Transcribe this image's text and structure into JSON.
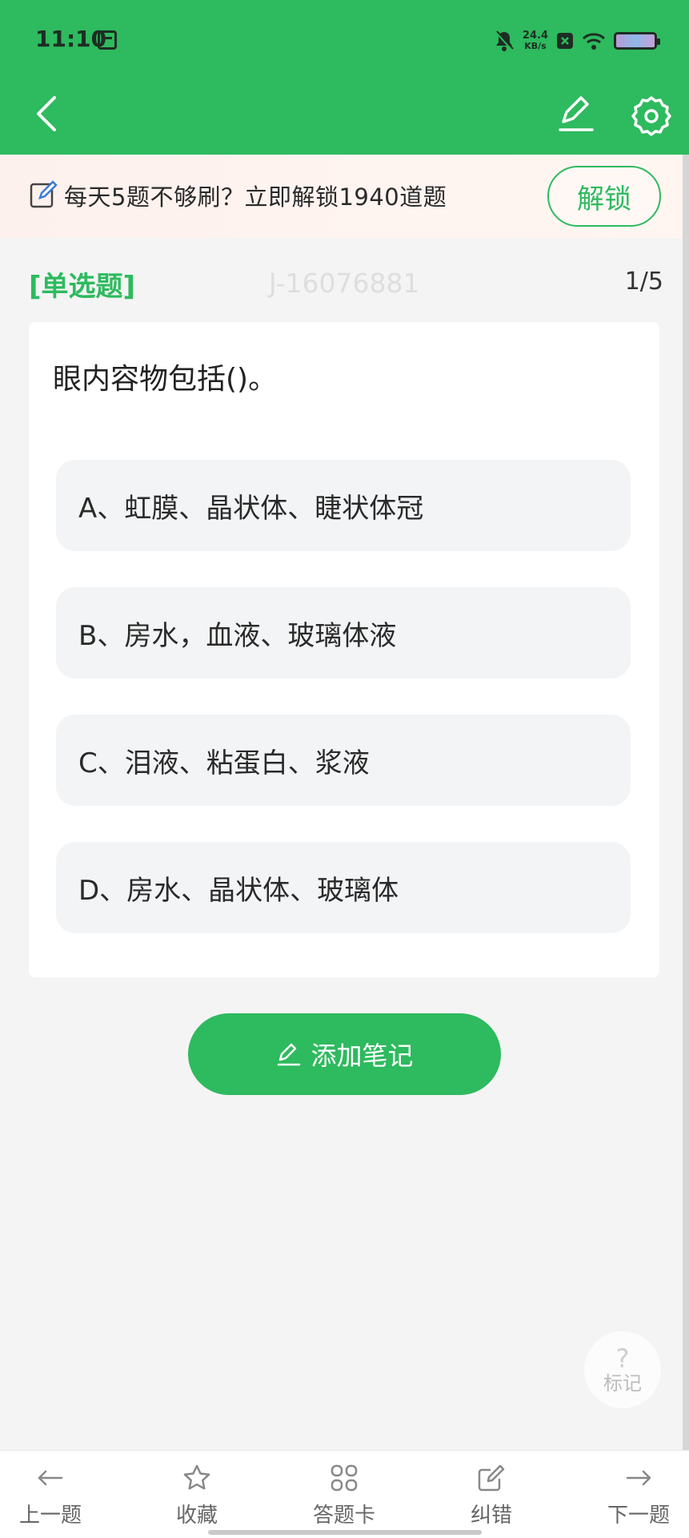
{
  "status_bar": {
    "time": "11:10",
    "net_speed_value": "24.4",
    "net_speed_unit": "KB/s"
  },
  "header": {
    "back_icon": "chevron-left-icon",
    "edit_icon": "pencil-icon",
    "settings_icon": "gear-icon"
  },
  "banner": {
    "text": "每天5题不够刷？立即解锁1940道题",
    "unlock_label": "解锁"
  },
  "question": {
    "type": "[单选题]",
    "id": "J-16076881",
    "progress": "1/5",
    "text": "眼内容物包括()。",
    "options": [
      {
        "label": "A、虹膜、晶状体、睫状体冠"
      },
      {
        "label": "B、房水，血液、玻璃体液"
      },
      {
        "label": "C、泪液、粘蛋白、浆液"
      },
      {
        "label": "D、房水、晶状体、玻璃体"
      }
    ]
  },
  "add_note_label": "添加笔记",
  "mark": {
    "glyph": "?",
    "label": "标记"
  },
  "bottom_nav": [
    {
      "label": "上一题",
      "icon": "arrow-left-icon"
    },
    {
      "label": "收藏",
      "icon": "star-icon"
    },
    {
      "label": "答题卡",
      "icon": "grid-icon"
    },
    {
      "label": "纠错",
      "icon": "edit-square-icon"
    },
    {
      "label": "下一题",
      "icon": "arrow-right-icon"
    }
  ],
  "colors": {
    "brand_green": "#2eba5e",
    "option_bg": "#f3f4f6",
    "page_bg": "#f4f4f4"
  }
}
